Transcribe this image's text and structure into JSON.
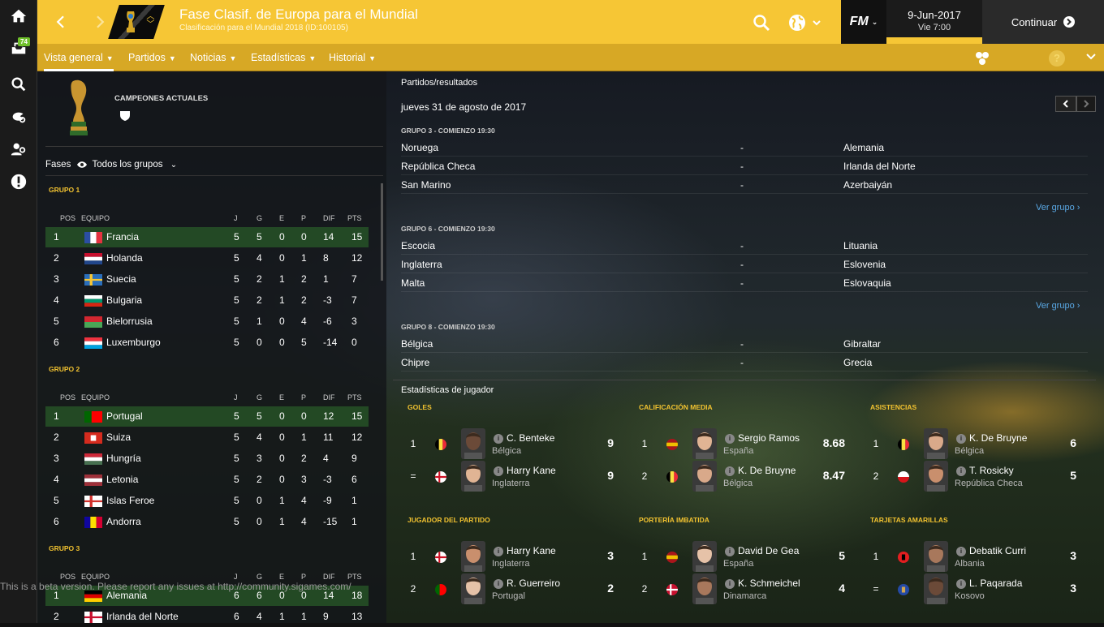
{
  "rail": {
    "badge": "74"
  },
  "header": {
    "title": "Fase Clasif. de Europa para el Mundial",
    "subtitle": "Clasificación para el Mundial 2018 (ID:100105)",
    "fm_label": "FM",
    "date": "9-Jun-2017",
    "day_time": "Vie 7:00",
    "continue_label": "Continuar",
    "accent_color": "#f6c635"
  },
  "tabs": [
    {
      "label": "Vista general",
      "active": true
    },
    {
      "label": "Partidos",
      "active": false
    },
    {
      "label": "Noticias",
      "active": false
    },
    {
      "label": "Estadísticas",
      "active": false
    },
    {
      "label": "Historial",
      "active": false
    }
  ],
  "left": {
    "champions_label": "CAMPEONES ACTUALES",
    "fases_label": "Fases",
    "fases_value": "Todos los grupos",
    "head": {
      "pos": "POS",
      "equipo": "EQUIPO",
      "j": "J",
      "g": "G",
      "e": "E",
      "p": "P",
      "dif": "DIF",
      "pts": "PTS"
    },
    "groups": [
      {
        "name": "GRUPO 1",
        "rows": [
          {
            "pos": "1",
            "team": "Francia",
            "flag": "fr",
            "j": "5",
            "g": "5",
            "e": "0",
            "p": "0",
            "dif": "14",
            "pts": "15"
          },
          {
            "pos": "2",
            "team": "Holanda",
            "flag": "nl",
            "j": "5",
            "g": "4",
            "e": "0",
            "p": "1",
            "dif": "8",
            "pts": "12"
          },
          {
            "pos": "3",
            "team": "Suecia",
            "flag": "se",
            "j": "5",
            "g": "2",
            "e": "1",
            "p": "2",
            "dif": "1",
            "pts": "7"
          },
          {
            "pos": "4",
            "team": "Bulgaria",
            "flag": "bg",
            "j": "5",
            "g": "2",
            "e": "1",
            "p": "2",
            "dif": "-3",
            "pts": "7"
          },
          {
            "pos": "5",
            "team": "Bielorrusia",
            "flag": "by",
            "j": "5",
            "g": "1",
            "e": "0",
            "p": "4",
            "dif": "-6",
            "pts": "3"
          },
          {
            "pos": "6",
            "team": "Luxemburgo",
            "flag": "lu",
            "j": "5",
            "g": "0",
            "e": "0",
            "p": "5",
            "dif": "-14",
            "pts": "0"
          }
        ]
      },
      {
        "name": "GRUPO 2",
        "rows": [
          {
            "pos": "1",
            "team": "Portugal",
            "flag": "pt",
            "j": "5",
            "g": "5",
            "e": "0",
            "p": "0",
            "dif": "12",
            "pts": "15"
          },
          {
            "pos": "2",
            "team": "Suiza",
            "flag": "ch",
            "j": "5",
            "g": "4",
            "e": "0",
            "p": "1",
            "dif": "11",
            "pts": "12"
          },
          {
            "pos": "3",
            "team": "Hungría",
            "flag": "hu",
            "j": "5",
            "g": "3",
            "e": "0",
            "p": "2",
            "dif": "4",
            "pts": "9"
          },
          {
            "pos": "4",
            "team": "Letonia",
            "flag": "lv",
            "j": "5",
            "g": "2",
            "e": "0",
            "p": "3",
            "dif": "-3",
            "pts": "6"
          },
          {
            "pos": "5",
            "team": "Islas Feroe",
            "flag": "fo",
            "j": "5",
            "g": "0",
            "e": "1",
            "p": "4",
            "dif": "-9",
            "pts": "1"
          },
          {
            "pos": "6",
            "team": "Andorra",
            "flag": "ad",
            "j": "5",
            "g": "0",
            "e": "1",
            "p": "4",
            "dif": "-15",
            "pts": "1"
          }
        ]
      },
      {
        "name": "GRUPO 3",
        "rows": [
          {
            "pos": "1",
            "team": "Alemania",
            "flag": "de",
            "j": "6",
            "g": "6",
            "e": "0",
            "p": "0",
            "dif": "14",
            "pts": "18"
          },
          {
            "pos": "2",
            "team": "Irlanda del Norte",
            "flag": "nir",
            "j": "6",
            "g": "4",
            "e": "1",
            "p": "1",
            "dif": "9",
            "pts": "13"
          }
        ]
      }
    ]
  },
  "matches": {
    "header": "Partidos/resultados",
    "date": "jueves 31 de agosto de 2017",
    "ver_grupo": "Ver grupo",
    "groups": [
      {
        "label": "GRUPO 3 - COMIENZO 19:30",
        "games": [
          {
            "home": "Noruega",
            "sep": "-",
            "away": "Alemania"
          },
          {
            "home": "República Checa",
            "sep": "-",
            "away": "Irlanda del Norte"
          },
          {
            "home": "San Marino",
            "sep": "-",
            "away": "Azerbaiyán"
          }
        ]
      },
      {
        "label": "GRUPO 6 - COMIENZO 19:30",
        "games": [
          {
            "home": "Escocia",
            "sep": "-",
            "away": "Lituania"
          },
          {
            "home": "Inglaterra",
            "sep": "-",
            "away": "Eslovenia"
          },
          {
            "home": "Malta",
            "sep": "-",
            "away": "Eslovaquia"
          }
        ]
      },
      {
        "label": "GRUPO 8 - COMIENZO 19:30",
        "games": [
          {
            "home": "Bélgica",
            "sep": "-",
            "away": "Gibraltar"
          },
          {
            "home": "Chipre",
            "sep": "-",
            "away": "Grecia"
          }
        ]
      }
    ]
  },
  "stats": {
    "header": "Estadísticas de jugador",
    "cats": [
      {
        "title": "GOLES",
        "rows": [
          {
            "rank": "1",
            "name": "C. Benteke",
            "club": "Bélgica",
            "value": "9",
            "flag": "be"
          },
          {
            "rank": "=",
            "name": "Harry Kane",
            "club": "Inglaterra",
            "value": "9",
            "flag": "en"
          }
        ]
      },
      {
        "title": "CALIFICACIÓN MEDIA",
        "rows": [
          {
            "rank": "1",
            "name": "Sergio Ramos",
            "club": "España",
            "value": "8.68",
            "flag": "es"
          },
          {
            "rank": "2",
            "name": "K. De Bruyne",
            "club": "Bélgica",
            "value": "8.47",
            "flag": "be"
          }
        ]
      },
      {
        "title": "ASISTENCIAS",
        "rows": [
          {
            "rank": "1",
            "name": "K. De Bruyne",
            "club": "Bélgica",
            "value": "6",
            "flag": "be"
          },
          {
            "rank": "2",
            "name": "T. Rosicky",
            "club": "República Checa",
            "value": "5",
            "flag": "cz"
          }
        ]
      },
      {
        "title": "JUGADOR DEL PARTIDO",
        "rows": [
          {
            "rank": "1",
            "name": "Harry Kane",
            "club": "Inglaterra",
            "value": "3",
            "flag": "en"
          },
          {
            "rank": "2",
            "name": "R. Guerreiro",
            "club": "Portugal",
            "value": "2",
            "flag": "pt"
          }
        ]
      },
      {
        "title": "PORTERÍA IMBATIDA",
        "rows": [
          {
            "rank": "1",
            "name": "David De Gea",
            "club": "España",
            "value": "5",
            "flag": "es"
          },
          {
            "rank": "2",
            "name": "K. Schmeichel",
            "club": "Dinamarca",
            "value": "4",
            "flag": "dk"
          }
        ]
      },
      {
        "title": "TARJETAS AMARILLAS",
        "rows": [
          {
            "rank": "1",
            "name": "Debatik Curri",
            "club": "Albania",
            "value": "3",
            "flag": "al"
          },
          {
            "rank": "=",
            "name": "L. Paqarada",
            "club": "Kosovo",
            "value": "3",
            "flag": "xk"
          }
        ]
      }
    ]
  },
  "beta_notice": "This is a beta version. Please report any issues at http://community.sigames.com/"
}
